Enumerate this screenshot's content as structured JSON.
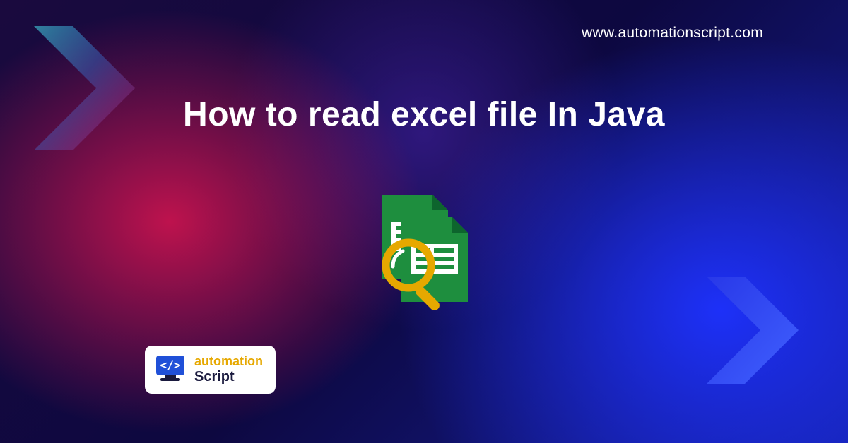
{
  "website_url": "www.automationscript.com",
  "title": "How to read excel file In Java",
  "logo": {
    "line1": "automation",
    "line2": "Script"
  },
  "colors": {
    "sheet_green": "#1e8e3e",
    "sheet_dark_green": "#0d652d",
    "magnifier_yellow": "#e6a800",
    "chevron_cyan": "#3dd8e8",
    "chevron_blue": "#2040d8"
  },
  "icons": {
    "left_chevron": "chevron-right-icon",
    "right_chevron": "chevron-right-icon",
    "center": "spreadsheet-search-icon",
    "logo": "code-monitor-icon"
  }
}
